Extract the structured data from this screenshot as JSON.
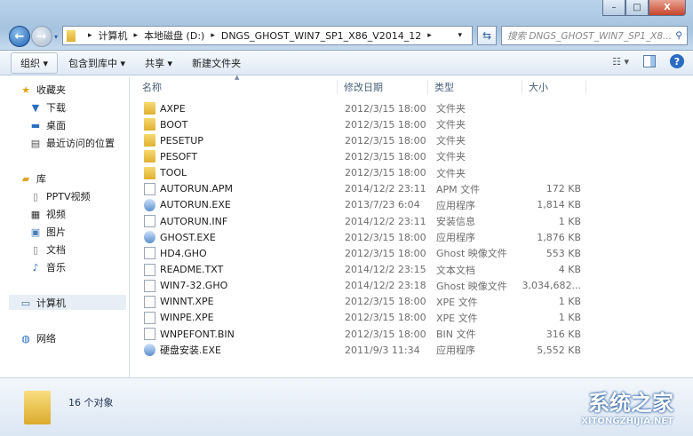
{
  "window": {
    "minimize": "–",
    "maximize": "□",
    "close": "X"
  },
  "address": {
    "segments": [
      "计算机",
      "本地磁盘 (D:)",
      "DNGS_GHOST_WIN7_SP1_X86_V2014_12"
    ],
    "separator": "▸"
  },
  "search": {
    "placeholder": "搜索 DNGS_GHOST_WIN7_SP1_X8..."
  },
  "toolbar": {
    "organize": "组织 ▾",
    "include": "包含到库中 ▾",
    "share": "共享 ▾",
    "new_folder": "新建文件夹"
  },
  "columns": {
    "name": "名称",
    "date": "修改日期",
    "type": "类型",
    "size": "大小"
  },
  "sidebar": {
    "favorites": "收藏夹",
    "downloads": "下载",
    "desktop": "桌面",
    "recent": "最近访问的位置",
    "libraries": "库",
    "pptv": "PPTV视频",
    "videos": "视频",
    "pictures": "图片",
    "documents": "文档",
    "music": "音乐",
    "computer": "计算机",
    "network": "网络"
  },
  "files": [
    {
      "name": "AXPE",
      "date": "2012/3/15 18:00",
      "type": "文件夹",
      "size": "",
      "icon": "folder"
    },
    {
      "name": "BOOT",
      "date": "2012/3/15 18:00",
      "type": "文件夹",
      "size": "",
      "icon": "folder"
    },
    {
      "name": "PESETUP",
      "date": "2012/3/15 18:00",
      "type": "文件夹",
      "size": "",
      "icon": "folder"
    },
    {
      "name": "PESOFT",
      "date": "2012/3/15 18:00",
      "type": "文件夹",
      "size": "",
      "icon": "folder"
    },
    {
      "name": "TOOL",
      "date": "2012/3/15 18:00",
      "type": "文件夹",
      "size": "",
      "icon": "folder"
    },
    {
      "name": "AUTORUN.APM",
      "date": "2014/12/2 23:11",
      "type": "APM 文件",
      "size": "172 KB",
      "icon": "file"
    },
    {
      "name": "AUTORUN.EXE",
      "date": "2013/7/23 6:04",
      "type": "应用程序",
      "size": "1,814 KB",
      "icon": "exe"
    },
    {
      "name": "AUTORUN.INF",
      "date": "2014/12/2 23:11",
      "type": "安装信息",
      "size": "1 KB",
      "icon": "file"
    },
    {
      "name": "GHOST.EXE",
      "date": "2012/3/15 18:00",
      "type": "应用程序",
      "size": "1,876 KB",
      "icon": "exe"
    },
    {
      "name": "HD4.GHO",
      "date": "2012/3/15 18:00",
      "type": "Ghost 映像文件",
      "size": "553 KB",
      "icon": "file"
    },
    {
      "name": "README.TXT",
      "date": "2014/12/2 23:15",
      "type": "文本文档",
      "size": "4 KB",
      "icon": "file"
    },
    {
      "name": "WIN7-32.GHO",
      "date": "2014/12/2 23:18",
      "type": "Ghost 映像文件",
      "size": "3,034,682...",
      "icon": "file"
    },
    {
      "name": "WINNT.XPE",
      "date": "2012/3/15 18:00",
      "type": "XPE 文件",
      "size": "1 KB",
      "icon": "file"
    },
    {
      "name": "WINPE.XPE",
      "date": "2012/3/15 18:00",
      "type": "XPE 文件",
      "size": "1 KB",
      "icon": "file"
    },
    {
      "name": "WNPEFONT.BIN",
      "date": "2012/3/15 18:00",
      "type": "BIN 文件",
      "size": "316 KB",
      "icon": "file"
    },
    {
      "name": "硬盘安装.EXE",
      "date": "2011/9/3 11:34",
      "type": "应用程序",
      "size": "5,552 KB",
      "icon": "exe"
    }
  ],
  "status": {
    "count": "16 个对象"
  },
  "watermark": {
    "cn": "系统之家",
    "en": "XITONGZHIJIA.NET"
  }
}
